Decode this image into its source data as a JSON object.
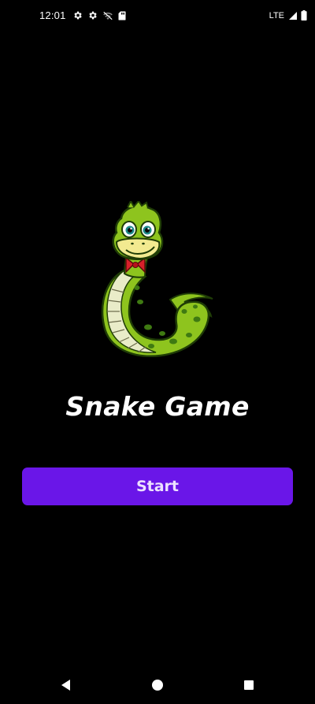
{
  "status_bar": {
    "time": "12:01",
    "network_type": "LTE",
    "left_icons": [
      "gear-icon",
      "gear-icon",
      "wifi-off-icon",
      "sd-card-icon"
    ],
    "right_icons": [
      "signal-icon",
      "battery-icon"
    ]
  },
  "app": {
    "title": "Snake Game",
    "start_label": "Start",
    "logo": "snake-logo"
  },
  "nav_bar": {
    "buttons": [
      "back-icon",
      "home-icon",
      "recents-icon"
    ]
  },
  "colors": {
    "background": "#000000",
    "button": "#6a16e8",
    "button_text": "#ece0ff",
    "title": "#ffffff"
  }
}
